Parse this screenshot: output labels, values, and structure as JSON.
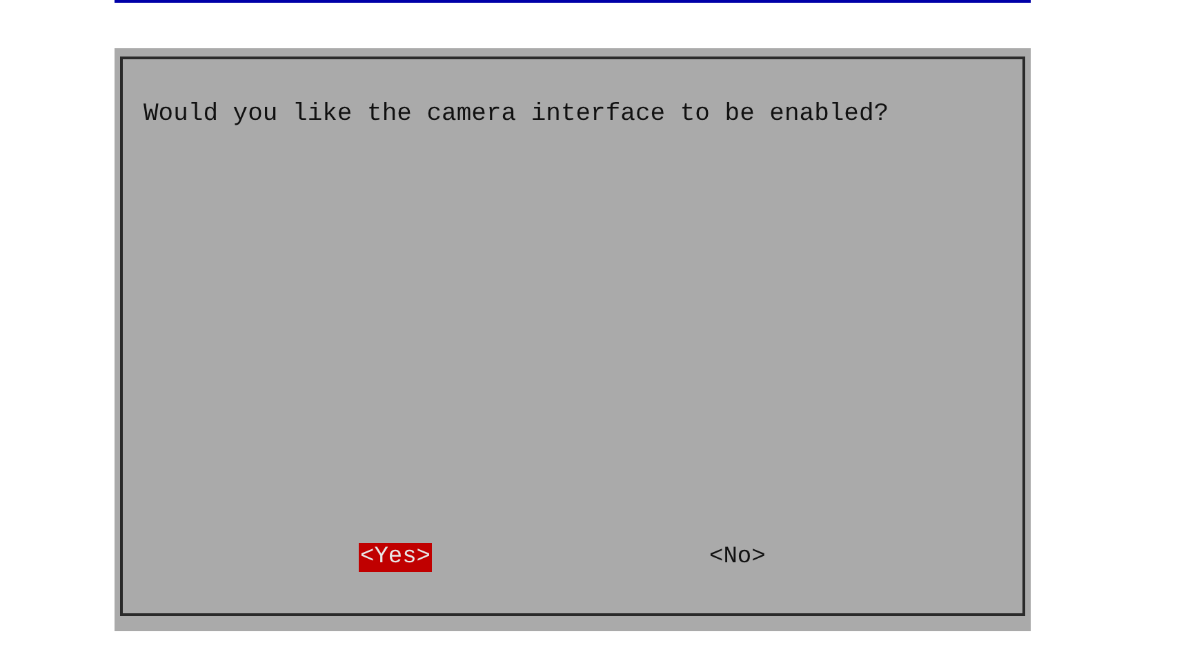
{
  "dialog": {
    "message": "Would you like the camera interface to be enabled?",
    "buttons": [
      {
        "label": "<Yes>",
        "selected": true
      },
      {
        "label": "<No>",
        "selected": false
      }
    ]
  }
}
